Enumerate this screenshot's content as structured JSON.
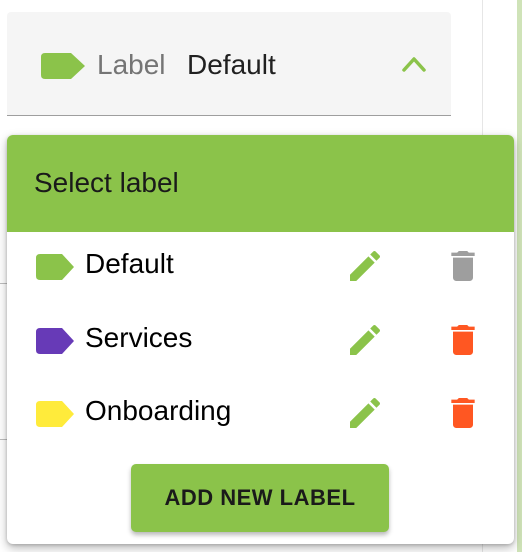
{
  "select": {
    "label": "Label",
    "value": "Default",
    "tag_color": "#8bc34a",
    "toggle_icon": "chevron-up-icon"
  },
  "menu": {
    "title": "Select label",
    "header_color": "#8bc34a",
    "items": [
      {
        "name": "Default",
        "color": "#8bc34a",
        "edit_icon": "pencil-icon",
        "delete_icon": "trash-icon",
        "delete_enabled": false
      },
      {
        "name": "Services",
        "color": "#673ab7",
        "edit_icon": "pencil-icon",
        "delete_icon": "trash-icon",
        "delete_enabled": true
      },
      {
        "name": "Onboarding",
        "color": "#ffeb3b",
        "edit_icon": "pencil-icon",
        "delete_icon": "trash-icon",
        "delete_enabled": true
      }
    ],
    "add_button": "ADD NEW LABEL"
  },
  "colors": {
    "accent": "#8bc34a",
    "edit_icon": "#8bc34a",
    "delete_active": "#ff5722",
    "delete_disabled": "#9e9e9e"
  }
}
